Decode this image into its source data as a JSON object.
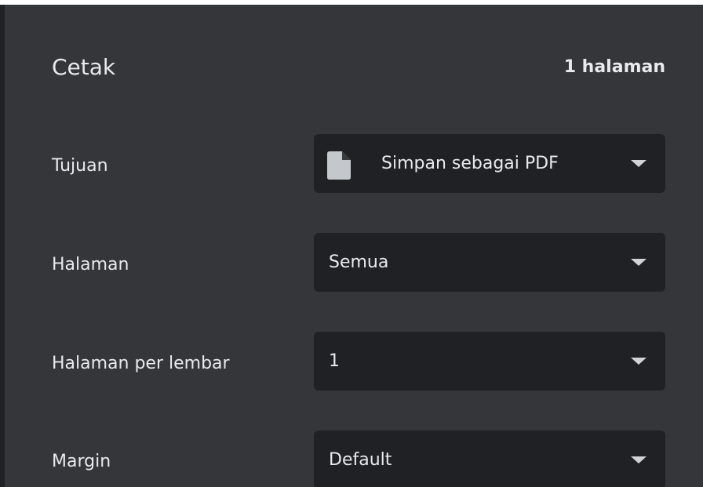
{
  "header": {
    "title": "Cetak",
    "page_count": "1 halaman"
  },
  "settings": [
    {
      "label": "Tujuan",
      "value": "Simpan sebagai PDF",
      "icon": "file-icon"
    },
    {
      "label": "Halaman",
      "value": "Semua"
    },
    {
      "label": "Halaman per lembar",
      "value": "1"
    },
    {
      "label": "Margin",
      "value": "Default"
    }
  ],
  "colors": {
    "panel_background": "#35363a",
    "select_background": "#202124",
    "text": "#e8eaed"
  }
}
